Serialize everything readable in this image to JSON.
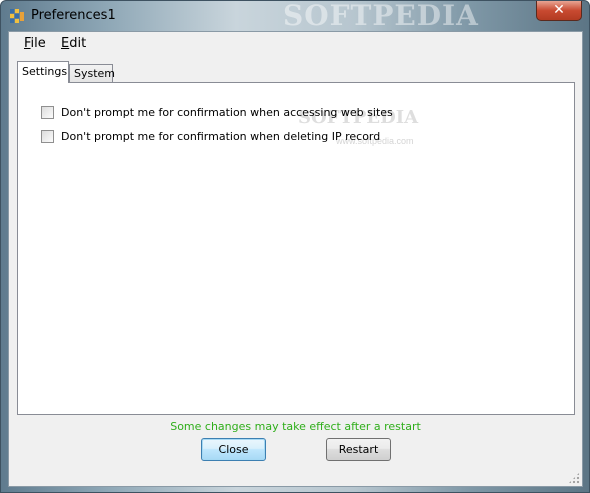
{
  "window": {
    "title": "Preferences1",
    "watermark": "SOFTPEDIA",
    "close_glyph": "✕"
  },
  "menubar": {
    "items": [
      {
        "label_mnemonic": "F",
        "label_rest": "ile"
      },
      {
        "label_mnemonic": "E",
        "label_rest": "dit"
      }
    ]
  },
  "tabs": [
    {
      "label": "Settings",
      "active": true
    },
    {
      "label": "System",
      "active": false
    }
  ],
  "settings": {
    "options": [
      {
        "label": "Don't prompt me for confirmation when accessing web sites",
        "checked": false
      },
      {
        "label": "Don't prompt me for confirmation when deleting IP record",
        "checked": false
      }
    ],
    "watermark": "SOFTPEDIA",
    "watermark_small": "www.softpedia.com"
  },
  "status": {
    "text": "Some changes may take effect after a restart",
    "color": "#2fae1a"
  },
  "buttons": {
    "close_label": "Close",
    "restart_label": "Restart"
  },
  "icons": {
    "app": "app-grid-icon",
    "close": "close-icon",
    "grip": "resize-grip-icon"
  }
}
